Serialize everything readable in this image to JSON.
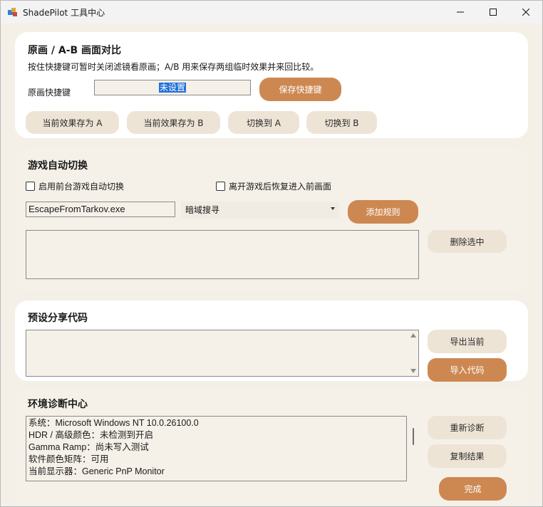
{
  "window": {
    "title": "ShadePilot 工具中心"
  },
  "ab_section": {
    "heading": "原画 / A-B 画面对比",
    "description": "按住快捷键可暂时关闭滤镜看原画；A/B 用来保存两组临时效果并来回比较。",
    "hotkey_label": "原画快捷键",
    "hotkey_value": "未设置",
    "save_hotkey": "保存快捷键",
    "buttons": [
      "当前效果存为 A",
      "当前效果存为 B",
      "切换到 A",
      "切换到 B"
    ]
  },
  "auto_switch": {
    "heading": "游戏自动切换",
    "enable_label": "启用前台游戏自动切换",
    "restore_label": "离开游戏后恢复进入前画面",
    "exe_value": "EscapeFromTarkov.exe",
    "preset_selected": "暗域搜寻",
    "add_rule": "添加规则",
    "delete_selected": "删除选中"
  },
  "share": {
    "heading": "预设分享代码",
    "export": "导出当前",
    "import": "导入代码"
  },
  "diagnostics": {
    "heading": "环境诊断中心",
    "lines": [
      "系统：Microsoft Windows NT 10.0.26100.0",
      "HDR / 高级颜色：未检测到开启",
      "Gamma Ramp：尚未写入测试",
      "软件颜色矩阵：可用",
      "当前显示器：Generic PnP Monitor"
    ],
    "rediagnose": "重新诊断",
    "copy": "复制结果",
    "done": "完成"
  }
}
